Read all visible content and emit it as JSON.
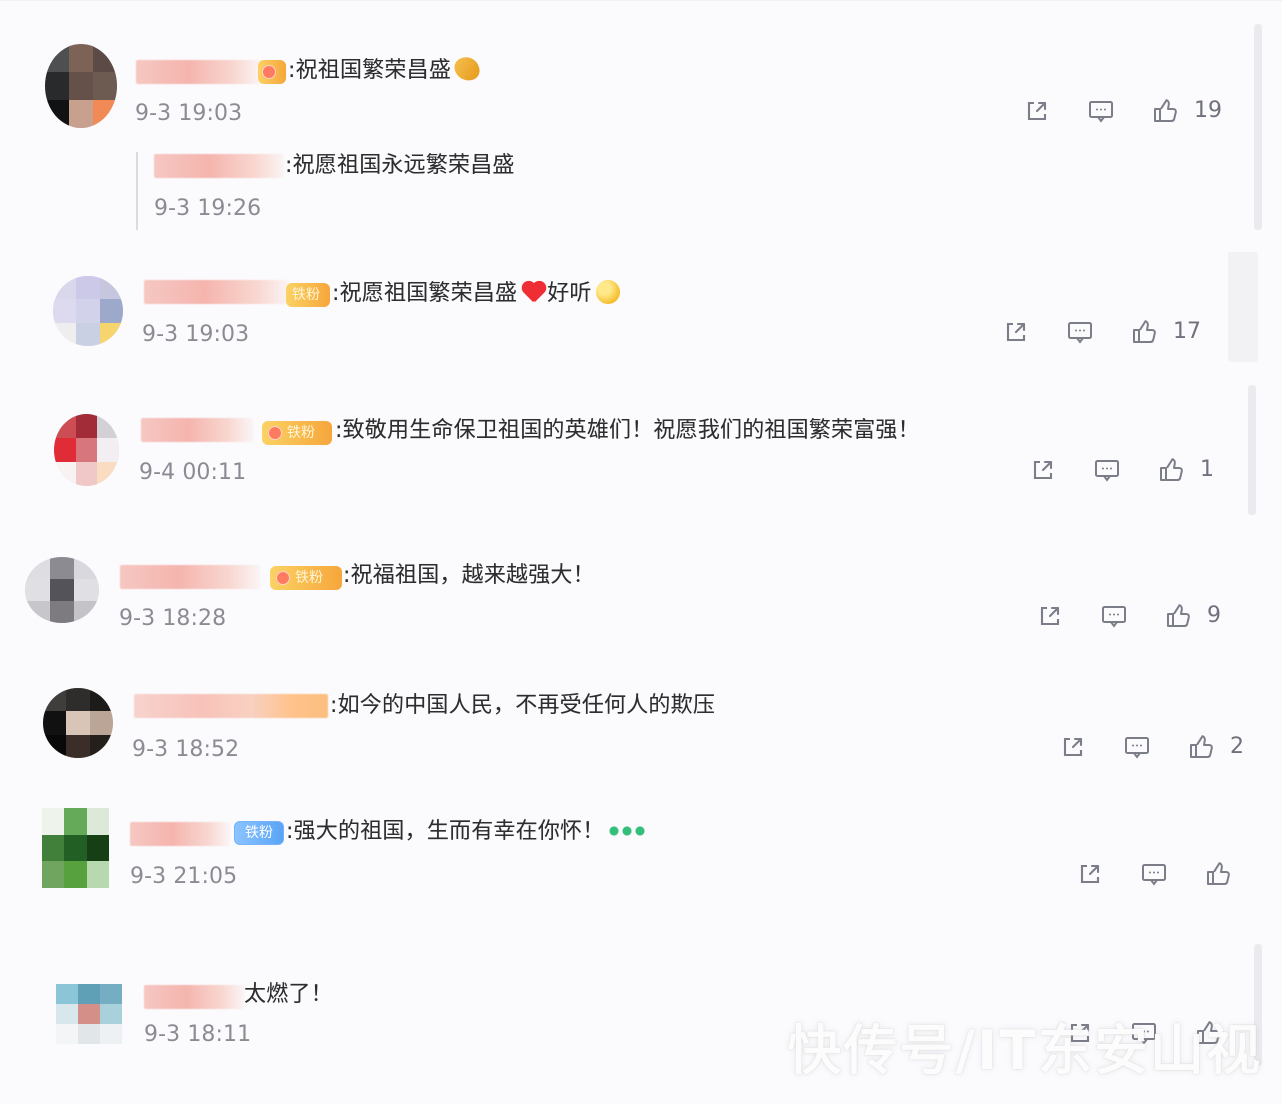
{
  "comments": [
    {
      "text": ":祝祖国繁荣昌盛",
      "time": "9-3 19:03",
      "counts": {
        "like": "19"
      },
      "reply": {
        "text": ":祝愿祖国永远繁荣昌盛",
        "time": "9-3 19:26"
      }
    },
    {
      "badge": "铁粉",
      "text": ":祝愿祖国繁荣昌盛",
      "tail_text": "好听",
      "time": "9-3 19:03",
      "counts": {
        "like": "17"
      }
    },
    {
      "badge": "铁粉",
      "text": ":致敬用生命保卫祖国的英雄们！祝愿我们的祖国繁荣富强！",
      "time": "9-4 00:11",
      "counts": {
        "like": "1"
      }
    },
    {
      "badge": "铁粉",
      "text": ":祝福祖国，越来越强大！",
      "time": "9-3 18:28",
      "counts": {
        "like": "9"
      }
    },
    {
      "text": ":如今的中国人民，不再受任何人的欺压",
      "time": "9-3 18:52",
      "counts": {
        "like": "2"
      }
    },
    {
      "badge": "铁粉",
      "text": ":强大的祖国，生而有幸在你怀！",
      "time": "9-3 21:05",
      "counts": {
        "like": ""
      }
    },
    {
      "text": "太燃了！",
      "time": "9-3 18:11",
      "counts": {
        "like": ""
      }
    }
  ],
  "icons": {
    "share": "share-icon",
    "comment": "comment-icon",
    "like": "thumbs-up-icon"
  },
  "watermark": "快传号/IT东安山视"
}
